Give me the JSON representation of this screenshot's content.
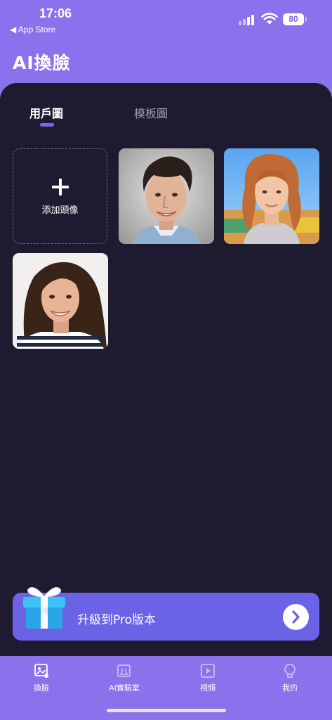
{
  "status_bar": {
    "time": "17:06",
    "back_label": "◀ App Store",
    "battery": "80",
    "icons": [
      "signal-icon",
      "wifi-icon",
      "battery-icon"
    ]
  },
  "header": {
    "title": "AI換臉"
  },
  "tabs": [
    {
      "label": "用戶圖",
      "selected": true
    },
    {
      "label": "模板圖",
      "selected": false
    }
  ],
  "add_tile": {
    "label": "添加頭像",
    "icon": "plus-icon"
  },
  "photos": [
    {
      "name": "user-photo-young-man"
    },
    {
      "name": "user-photo-curly-woman"
    },
    {
      "name": "user-photo-girl"
    }
  ],
  "upgrade": {
    "label": "升級到Pro版本",
    "icon": "gift-icon",
    "action_icon": "chevron-right-icon"
  },
  "bottom_nav": [
    {
      "label": "換臉",
      "icon": "face-swap-icon",
      "selected": true
    },
    {
      "label": "AI實驗室",
      "icon": "lab-icon",
      "selected": false
    },
    {
      "label": "視頻",
      "icon": "video-icon",
      "selected": false
    },
    {
      "label": "我的",
      "icon": "profile-icon",
      "selected": false
    }
  ],
  "colors": {
    "accent": "#8a72ec",
    "panel": "#1e1b30",
    "banner": "#6b63e6",
    "tab_indicator": "#7b67ee"
  }
}
